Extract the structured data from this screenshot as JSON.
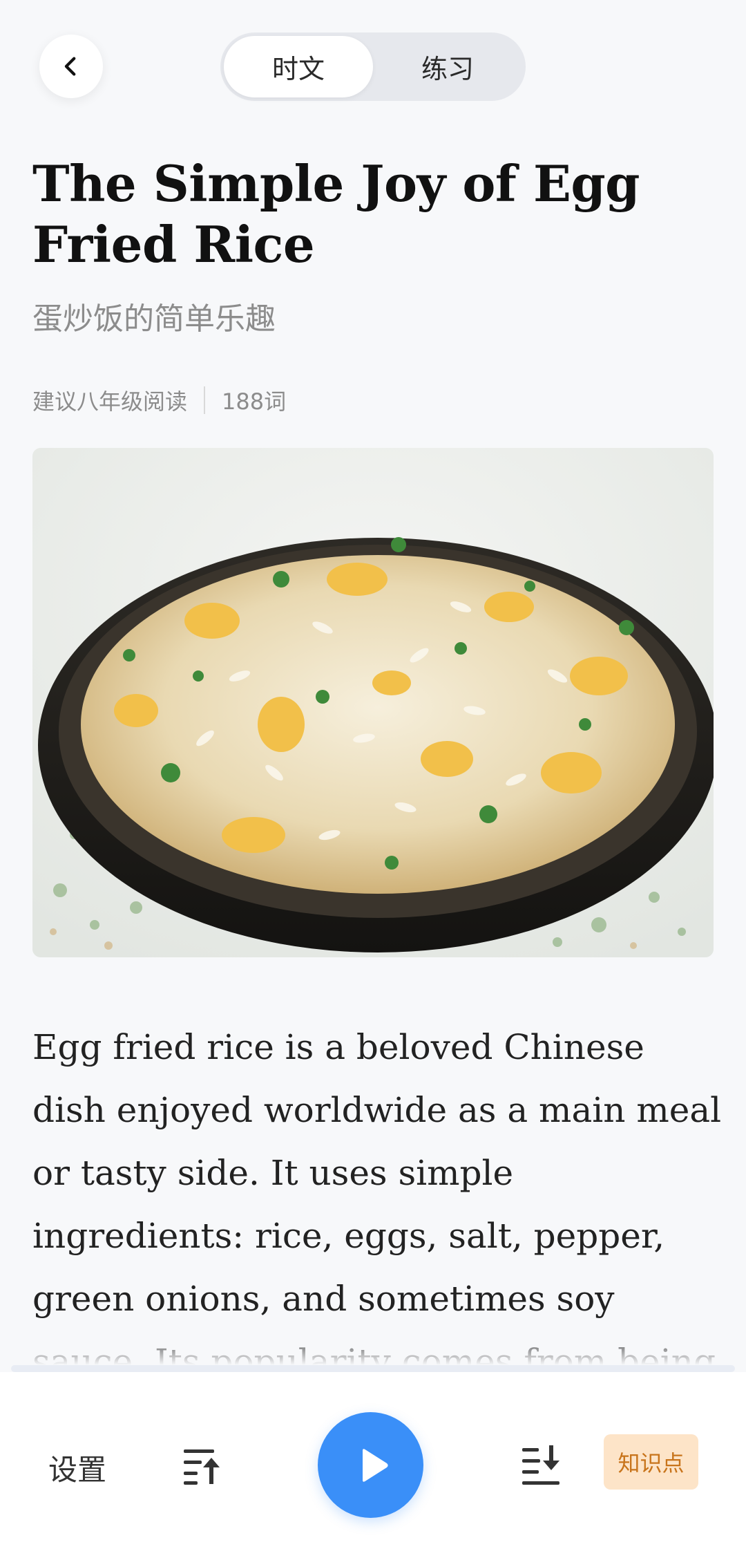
{
  "tabs": [
    {
      "label": "时文",
      "active": true
    },
    {
      "label": "练习",
      "active": false
    }
  ],
  "article": {
    "title": "The Simple Joy of Egg Fried Rice",
    "subtitle": "蛋炒饭的简单乐趣",
    "grade": "建议八年级阅读",
    "word_count": "188词",
    "body": "Egg fried rice is a beloved Chinese dish enjoyed worldwide as a main meal or tasty side. It uses simple ingredients: rice, eggs, salt, pepper, green onions, and sometimes soy sauce. Its popularity comes from being delicious, quick to"
  },
  "reading_progress": 0.0,
  "toolbar": {
    "settings_label": "设置",
    "knowledge_label": "知识点"
  },
  "colors": {
    "accent": "#3a8ff8",
    "knowledge_bg": "#fde4c8",
    "knowledge_text": "#c8741b",
    "background": "#f7f8fa"
  },
  "icons": {
    "back": "chevron-left-icon",
    "scroll_up": "list-arrow-up-icon",
    "play": "play-icon",
    "scroll_down": "list-arrow-down-icon"
  }
}
